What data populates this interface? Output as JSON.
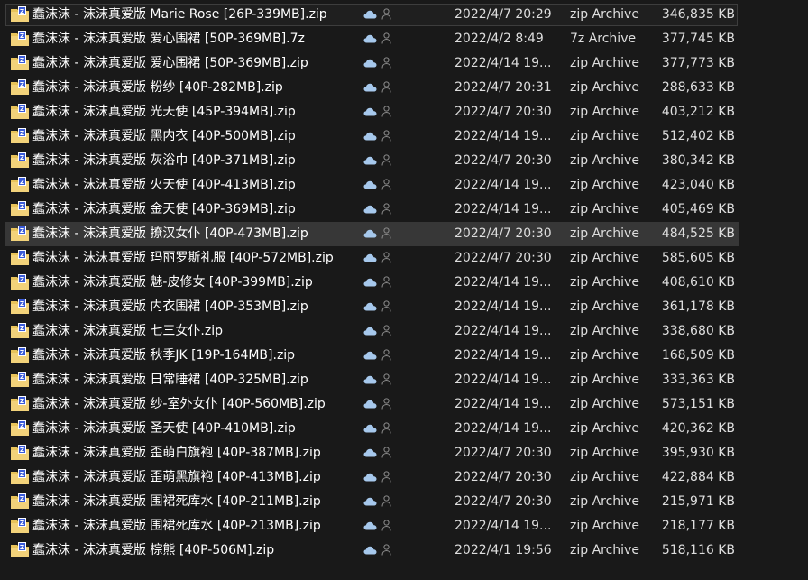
{
  "files": [
    {
      "name": "蠢沫沫 - 沫沫真爱版 Marie Rose [26P-339MB].zip",
      "date": "2022/4/7 20:29",
      "type": "zip Archive",
      "size": "346,835 KB",
      "state": "selected"
    },
    {
      "name": "蠢沫沫 - 沫沫真爱版 爱心围裙 [50P-369MB].7z",
      "date": "2022/4/2 8:49",
      "type": "7z Archive",
      "size": "377,745 KB",
      "state": ""
    },
    {
      "name": "蠢沫沫 - 沫沫真爱版 爱心围裙 [50P-369MB].zip",
      "date": "2022/4/14 19...",
      "type": "zip Archive",
      "size": "377,773 KB",
      "state": ""
    },
    {
      "name": "蠢沫沫 - 沫沫真爱版 粉纱 [40P-282MB].zip",
      "date": "2022/4/7 20:31",
      "type": "zip Archive",
      "size": "288,633 KB",
      "state": ""
    },
    {
      "name": "蠢沫沫 - 沫沫真爱版 光天使 [45P-394MB].zip",
      "date": "2022/4/7 20:30",
      "type": "zip Archive",
      "size": "403,212 KB",
      "state": ""
    },
    {
      "name": "蠢沫沫 - 沫沫真爱版 黑内衣 [40P-500MB].zip",
      "date": "2022/4/14 19...",
      "type": "zip Archive",
      "size": "512,402 KB",
      "state": ""
    },
    {
      "name": "蠢沫沫 - 沫沫真爱版 灰浴巾 [40P-371MB].zip",
      "date": "2022/4/7 20:30",
      "type": "zip Archive",
      "size": "380,342 KB",
      "state": ""
    },
    {
      "name": "蠢沫沫 - 沫沫真爱版 火天使 [40P-413MB].zip",
      "date": "2022/4/14 19...",
      "type": "zip Archive",
      "size": "423,040 KB",
      "state": ""
    },
    {
      "name": "蠢沫沫 - 沫沫真爱版 金天使 [40P-369MB].zip",
      "date": "2022/4/14 19...",
      "type": "zip Archive",
      "size": "405,469 KB",
      "state": ""
    },
    {
      "name": "蠢沫沫 - 沫沫真爱版 撩汉女仆 [40P-473MB].zip",
      "date": "2022/4/7 20:30",
      "type": "zip Archive",
      "size": "484,525 KB",
      "state": "hover"
    },
    {
      "name": "蠢沫沫 - 沫沫真爱版 玛丽罗斯礼服 [40P-572MB].zip",
      "date": "2022/4/7 20:30",
      "type": "zip Archive",
      "size": "585,605 KB",
      "state": ""
    },
    {
      "name": "蠢沫沫 - 沫沫真爱版 魅-皮修女 [40P-399MB].zip",
      "date": "2022/4/14 19...",
      "type": "zip Archive",
      "size": "408,610 KB",
      "state": ""
    },
    {
      "name": "蠢沫沫 - 沫沫真爱版 内衣围裙 [40P-353MB].zip",
      "date": "2022/4/14 19...",
      "type": "zip Archive",
      "size": "361,178 KB",
      "state": ""
    },
    {
      "name": "蠢沫沫 - 沫沫真爱版 七三女仆.zip",
      "date": "2022/4/14 19...",
      "type": "zip Archive",
      "size": "338,680 KB",
      "state": ""
    },
    {
      "name": "蠢沫沫 - 沫沫真爱版 秋季JK [19P-164MB].zip",
      "date": "2022/4/14 19...",
      "type": "zip Archive",
      "size": "168,509 KB",
      "state": ""
    },
    {
      "name": "蠢沫沫 - 沫沫真爱版 日常睡裙 [40P-325MB].zip",
      "date": "2022/4/14 19...",
      "type": "zip Archive",
      "size": "333,363 KB",
      "state": ""
    },
    {
      "name": "蠢沫沫 - 沫沫真爱版 纱-室外女仆 [40P-560MB].zip",
      "date": "2022/4/14 19...",
      "type": "zip Archive",
      "size": "573,151 KB",
      "state": ""
    },
    {
      "name": "蠢沫沫 - 沫沫真爱版 圣天使 [40P-410MB].zip",
      "date": "2022/4/14 19...",
      "type": "zip Archive",
      "size": "420,362 KB",
      "state": ""
    },
    {
      "name": "蠢沫沫 - 沫沫真爱版 歪萌白旗袍 [40P-387MB].zip",
      "date": "2022/4/7 20:30",
      "type": "zip Archive",
      "size": "395,930 KB",
      "state": ""
    },
    {
      "name": "蠢沫沫 - 沫沫真爱版 歪萌黑旗袍 [40P-413MB].zip",
      "date": "2022/4/7 20:30",
      "type": "zip Archive",
      "size": "422,884 KB",
      "state": ""
    },
    {
      "name": "蠢沫沫 - 沫沫真爱版 围裙死库水 [40P-211MB].zip",
      "date": "2022/4/7 20:30",
      "type": "zip Archive",
      "size": "215,971 KB",
      "state": ""
    },
    {
      "name": "蠢沫沫 - 沫沫真爱版 围裙死库水 [40P-213MB].zip",
      "date": "2022/4/14 19...",
      "type": "zip Archive",
      "size": "218,177 KB",
      "state": ""
    },
    {
      "name": "蠢沫沫 - 沫沫真爱版 棕熊 [40P-506M].zip",
      "date": "2022/4/1 19:56",
      "type": "zip Archive",
      "size": "518,116 KB",
      "state": ""
    }
  ],
  "icons": {
    "file": "zip-folder-icon",
    "sync": "cloud-icon",
    "share": "person-icon"
  },
  "colors": {
    "background": "#191919",
    "hover": "#373737",
    "folder": "#e8c35a",
    "zip_badge": "#3a5bd9",
    "cloud": "#a6c8ec"
  }
}
